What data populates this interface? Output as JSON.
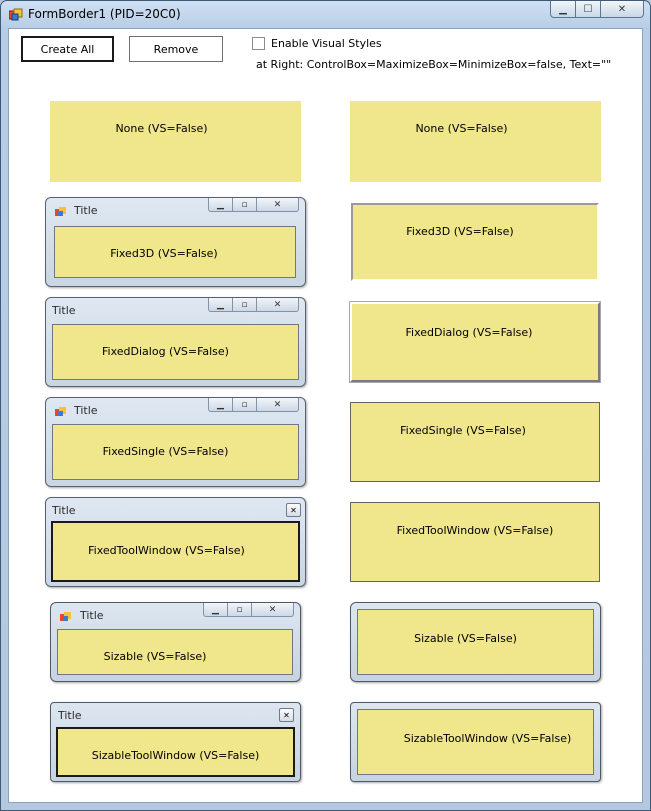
{
  "window": {
    "title": "FormBorder1 (PID=20C0)",
    "min_glyph": "▁",
    "max_glyph": "☐",
    "close_glyph": "✕"
  },
  "toolbar": {
    "create_all": "Create All",
    "remove": "Remove",
    "visual_styles_label": "Enable Visual Styles",
    "right_info": "at Right: ControlBox=MaximizeBox=MinimizeBox=false, Text=\"\""
  },
  "child_title": "Title",
  "child_glyphs": {
    "min": "▁",
    "max": "▫",
    "close": "✕",
    "tool_close": "✕"
  },
  "forms": {
    "none_left": "None  (VS=False)",
    "none_right": "None  (VS=False)",
    "fixed3d_left": "Fixed3D  (VS=False)",
    "fixed3d_right": "Fixed3D  (VS=False)",
    "fixeddialog_left": "FixedDialog  (VS=False)",
    "fixeddialog_right": "FixedDialog  (VS=False)",
    "fixedsingle_left": "FixedSingle  (VS=False)",
    "fixedsingle_right": "FixedSingle  (VS=False)",
    "fixedtool_left": "FixedToolWindow  (VS=False)",
    "fixedtool_right": "FixedToolWindow  (VS=False)",
    "sizable_left": "Sizable  (VS=False)",
    "sizable_right": "Sizable  (VS=False)",
    "sizabletool_left": "SizableToolWindow  (VS=False)",
    "sizabletool_right": "SizableToolWindow  (VS=False)"
  },
  "colors": {
    "form_back": "#f0e68c",
    "glass": "#c9d6e6"
  }
}
